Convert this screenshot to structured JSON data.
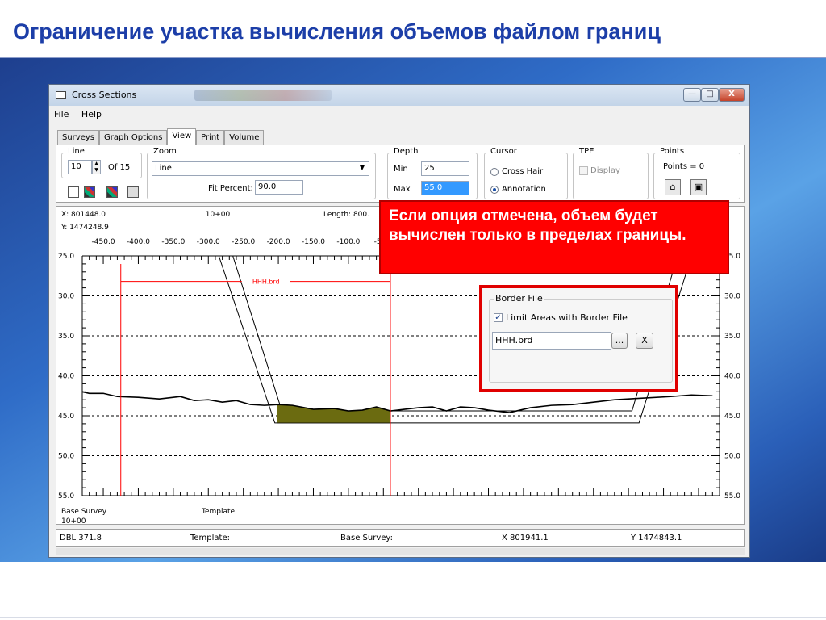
{
  "slide": {
    "title": "Ограничение участка вычисления объемов файлом границ"
  },
  "window": {
    "title": "Cross Sections",
    "controls": {
      "minimize": "—",
      "maximize": "□",
      "close": "X"
    }
  },
  "menu": [
    "File",
    "Help"
  ],
  "tabs": [
    {
      "label": "Surveys",
      "active": false
    },
    {
      "label": "Graph Options",
      "active": false
    },
    {
      "label": "View",
      "active": true
    },
    {
      "label": "Print",
      "active": false
    },
    {
      "label": "Volume",
      "active": false
    }
  ],
  "view_panel": {
    "line": {
      "label": "Line",
      "value": "10",
      "of": "Of 15"
    },
    "zoom": {
      "label": "Zoom",
      "value": "Line",
      "fit_label": "Fit Percent:",
      "fit_value": "90.0"
    },
    "depth": {
      "label": "Depth",
      "min_label": "Min",
      "min_value": "25",
      "max_label": "Max",
      "max_value": "55.0"
    },
    "cursor": {
      "label": "Cursor",
      "options": [
        "Cross Hair",
        "Annotation"
      ],
      "selected": "Annotation"
    },
    "tpe": {
      "label": "TPE",
      "display_label": "Display"
    },
    "points": {
      "label": "Points",
      "count": "Points = 0"
    }
  },
  "plot": {
    "x_readout": "X: 801448.0",
    "y_readout": "Y: 1474248.9",
    "station": "10+00",
    "length": "Length: 800.",
    "border_label": "HHH.brd",
    "base_survey_label": "Base Survey",
    "template_label": "Template",
    "station_bottom": "10+00"
  },
  "chart_data": {
    "type": "line",
    "x_tick_labels": [
      "-450.0",
      "-400.0",
      "-350.0",
      "-300.0",
      "-250.0",
      "-200.0",
      "-150.0",
      "-100.0",
      "-50.0"
    ],
    "y_ticks": [
      "25.0",
      "30.0",
      "35.0",
      "40.0",
      "45.0",
      "50.0",
      "55.0"
    ],
    "ylim": [
      25,
      55
    ],
    "xlim": [
      -480,
      430
    ],
    "y_inverted": true,
    "grid": "dashed horizontal",
    "series": [
      {
        "x": [
          -480,
          -470,
          -450,
          -430,
          -400,
          -370,
          -340,
          -320,
          -300,
          -280,
          -260,
          -240,
          -220,
          -200,
          -180,
          -150,
          -120,
          -100,
          -80,
          -60,
          -40,
          -20,
          0,
          20,
          40,
          60,
          80,
          100,
          130,
          160,
          190,
          220,
          250,
          280,
          320,
          360,
          390,
          420
        ],
        "y": [
          42.0,
          42.2,
          42.2,
          42.6,
          42.7,
          42.9,
          42.6,
          43.1,
          43.0,
          43.3,
          43.1,
          43.6,
          43.7,
          43.6,
          43.7,
          44.2,
          44.1,
          44.4,
          44.3,
          43.9,
          44.4,
          44.2,
          44.0,
          43.9,
          44.4,
          43.9,
          44.0,
          44.3,
          44.6,
          44.0,
          43.7,
          43.6,
          43.3,
          43.0,
          42.8,
          42.6,
          42.4,
          42.5
        ]
      }
    ],
    "template": {
      "left_top_x": [
        -285,
        -265
      ],
      "right_top_x": [
        370,
        390
      ],
      "bottom_x": [
        -205,
        315
      ],
      "top_y": 25,
      "bottom_y": 45.9
    },
    "border_x": [
      -425,
      -40
    ],
    "border_label": "HHH.brd",
    "fill_color": "#6b6b10"
  },
  "status": {
    "dbl": "DBL 371.8",
    "template": "Template:",
    "base_survey": "Base Survey:",
    "x": "X 801941.1",
    "y": "Y 1474843.1"
  },
  "callout": {
    "text": "Если опция отмечена, объем будет вычислен только в пределах границы."
  },
  "border_file": {
    "group_label": "Border File",
    "checkbox_label": "Limit Areas with Border File",
    "checked": true,
    "file_value": "HHH.brd",
    "browse_label": "...",
    "clear_label": "X"
  }
}
